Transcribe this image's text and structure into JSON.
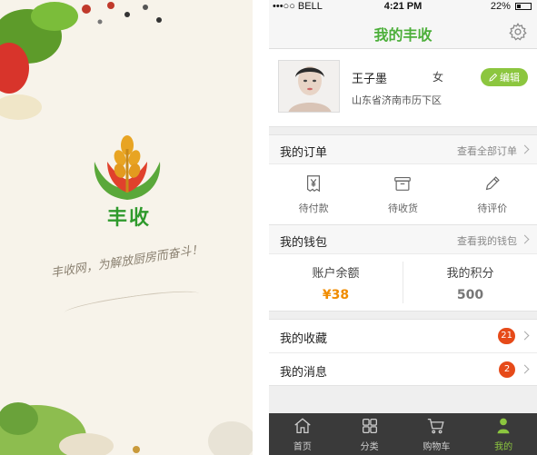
{
  "splash": {
    "brand": "丰收",
    "slogan": "丰收网，为解放厨房而奋斗！"
  },
  "status": {
    "carrier": "•••○○ BELL",
    "time": "4:21 PM",
    "battery": "22%"
  },
  "header": {
    "title": "我的丰收",
    "settings_icon": "gear-icon"
  },
  "profile": {
    "name": "王子墨",
    "gender": "女",
    "address": "山东省济南市历下区",
    "edit_label": "编辑"
  },
  "orders": {
    "title": "我的订单",
    "link": "查看全部订单",
    "items": [
      {
        "label": "待付款",
        "icon": "yuan-document-icon"
      },
      {
        "label": "待收货",
        "icon": "box-icon"
      },
      {
        "label": "待评价",
        "icon": "pencil-icon"
      }
    ]
  },
  "wallet": {
    "title": "我的钱包",
    "link": "查看我的钱包",
    "balance_label": "账户余额",
    "balance_value": "¥38",
    "points_label": "我的积分",
    "points_value": "500"
  },
  "lists": [
    {
      "label": "我的收藏",
      "badge": "21"
    },
    {
      "label": "我的消息",
      "badge": "2"
    }
  ],
  "tabbar": {
    "items": [
      {
        "label": "首页",
        "icon": "home-icon"
      },
      {
        "label": "分类",
        "icon": "grid-icon"
      },
      {
        "label": "购物车",
        "icon": "cart-icon"
      },
      {
        "label": "我的",
        "icon": "user-icon",
        "active": true
      }
    ]
  },
  "colors": {
    "accent": "#4caf3a",
    "edit_button": "#8cc63f",
    "balance": "#f08c00",
    "badge": "#e64a19",
    "tabbar": "#3a3a3a"
  }
}
